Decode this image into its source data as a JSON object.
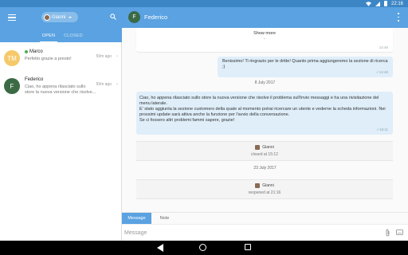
{
  "status_bar": {
    "time": "22:16"
  },
  "left_panel": {
    "user_name": "Gianni",
    "tabs": [
      {
        "label": "OPEN"
      },
      {
        "label": "CLOSED"
      }
    ],
    "conversations": [
      {
        "initials": "TM",
        "name": "Marco",
        "online": true,
        "preview": "Perfetto grazie a presto!",
        "time": "59m ago",
        "avatar_color": "#f5c96a"
      },
      {
        "initials": "F",
        "name": "Federico",
        "online": false,
        "preview": "Ciao, ho appena rilasciato sullo store la nuova versione che risolve...",
        "time": "59m ago",
        "avatar_color": "#3b6a45"
      }
    ]
  },
  "chat": {
    "avatar_initial": "F",
    "title": "Federico",
    "show_more": "Show more",
    "show_more_dash": "-",
    "show_more_time": "14:46",
    "messages": [
      {
        "text": "Benissimo! Ti ringrazio per le dritte! Quanto prima aggiungeremo la sezione di ricerca ;)",
        "time": "✓14:48"
      },
      {
        "text": "Ciao, ho appena rilasciato sullo store la nuova versione che risolve il problema sull'invio messaggi e ha una rivisitazione del menu laterale.\nE' stato aggiunta la sezione customers della quale al momento potrai ricercare un utente e vederne la scheda informazioni. Nei prossimi update sarà attiva anche la funzione per l'avvio della conversazione.\nSe ci fossero altri problemi fammi sapere, grazie!",
        "time": "✓15:11"
      }
    ],
    "date_1": "8 July 2017",
    "event_1": {
      "user": "Gianni",
      "text": "closed at 15:12"
    },
    "date_2": "23 July 2017",
    "event_2": {
      "user": "Gianni",
      "text": "reopened at 21:16"
    },
    "composer_tabs": [
      {
        "label": "Message"
      },
      {
        "label": "Note"
      }
    ],
    "composer_placeholder": "Message"
  },
  "colors": {
    "accent": "#5aa2e1",
    "status_bar": "#3d86c6",
    "bubble": "#dfeef9"
  }
}
